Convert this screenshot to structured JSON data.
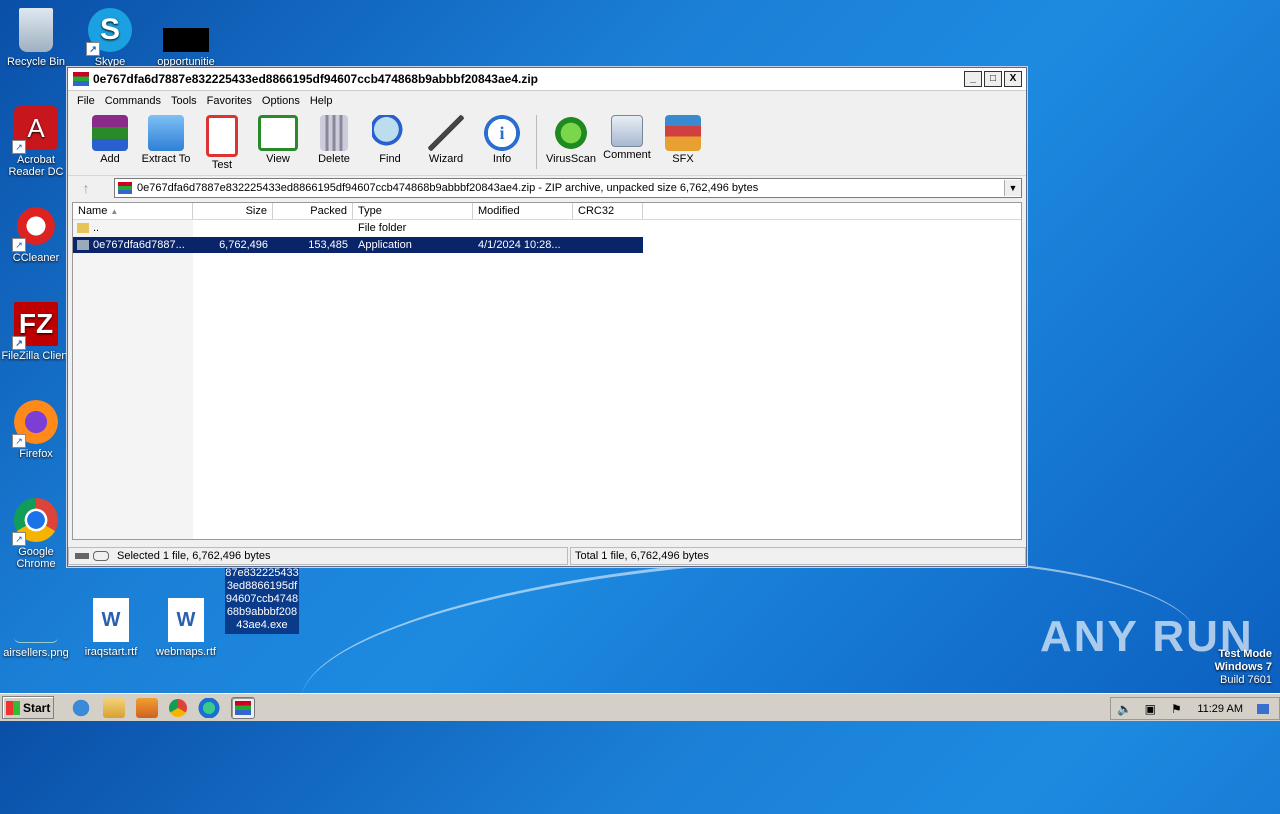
{
  "desktop": {
    "icons": [
      {
        "label": "Recycle Bin"
      },
      {
        "label": "Skype"
      },
      {
        "label": "opportunitie"
      },
      {
        "label": "Acrobat Reader DC"
      },
      {
        "label": "CCleaner"
      },
      {
        "label": "FileZilla Client"
      },
      {
        "label": "Firefox"
      },
      {
        "label": "Google Chrome"
      },
      {
        "label": "airsellers.png"
      },
      {
        "label": "iraqstart.rtf"
      },
      {
        "label": "webmaps.rtf"
      }
    ],
    "selected_file_lines": [
      "87e832225433",
      "3ed8866195df",
      "94607ccb4748",
      "68b9abbbf208",
      "43ae4.exe"
    ]
  },
  "window": {
    "title": "0e767dfa6d7887e832225433ed8866195df94607ccb474868b9abbbf20843ae4.zip",
    "controls": {
      "minimize": "_",
      "maximize": "□",
      "close": "X"
    },
    "menu": [
      "File",
      "Commands",
      "Tools",
      "Favorites",
      "Options",
      "Help"
    ],
    "toolbar": [
      {
        "label": "Add",
        "icon": "add-icon",
        "color": "#8b2a8b"
      },
      {
        "label": "Extract To",
        "icon": "extract-folder-icon",
        "color": "#3a88d8"
      },
      {
        "label": "Test",
        "icon": "test-clipboard-icon",
        "color": "#d33"
      },
      {
        "label": "View",
        "icon": "view-book-icon",
        "color": "#2a8a2a"
      },
      {
        "label": "Delete",
        "icon": "trash-icon",
        "color": "#7a8a9a"
      },
      {
        "label": "Find",
        "icon": "magnifier-icon",
        "color": "#2a5fd0"
      },
      {
        "label": "Wizard",
        "icon": "wand-icon",
        "color": "#9bd"
      },
      {
        "label": "Info",
        "icon": "info-icon",
        "color": "#2a6fd0"
      },
      {
        "label": "VirusScan",
        "icon": "virus-icon",
        "color": "#2faa2f"
      },
      {
        "label": "Comment",
        "icon": "comment-icon",
        "color": "#8aa0c0"
      },
      {
        "label": "SFX",
        "icon": "sfx-icon",
        "color": "#d04040"
      }
    ],
    "address": "0e767dfa6d7887e832225433ed8866195df94607ccb474868b9abbbf20843ae4.zip - ZIP archive, unpacked size 6,762,496 bytes",
    "columns": [
      "Name",
      "Size",
      "Packed",
      "Type",
      "Modified",
      "CRC32"
    ],
    "rows": [
      {
        "name": "..",
        "size": "",
        "packed": "",
        "type": "File folder",
        "modified": "",
        "crc": ""
      },
      {
        "name": "0e767dfa6d7887...",
        "size": "6,762,496",
        "packed": "153,485",
        "type": "Application",
        "modified": "4/1/2024 10:28...",
        "crc": ""
      }
    ],
    "status_left": "Selected 1 file, 6,762,496 bytes",
    "status_right": "Total 1 file, 6,762,496 bytes"
  },
  "taskbar": {
    "start_label": "Start",
    "clock": "11:29 AM"
  },
  "watermark": {
    "line1": "Test Mode",
    "line2": "Windows 7",
    "line3": "Build 7601",
    "brand": "ANY RUN"
  }
}
